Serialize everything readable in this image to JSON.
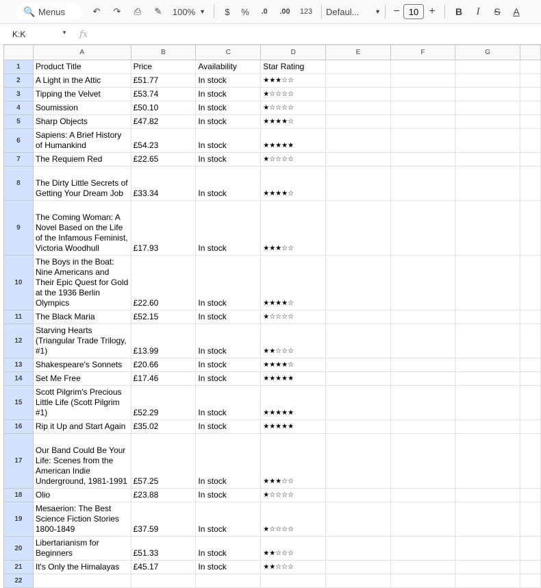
{
  "toolbar": {
    "menus_label": "Menus",
    "zoom": "100%",
    "currency": "$",
    "percent": "%",
    "dec_decrease": ".0",
    "dec_increase": ".00",
    "number_format": "123",
    "font_family": "Defaul...",
    "font_size": "10",
    "bold": "B",
    "italic": "I",
    "strike": "S",
    "text_color": "A"
  },
  "formula_bar": {
    "name_box": "K:K",
    "fx": "fx"
  },
  "columns": [
    "A",
    "B",
    "C",
    "D",
    "E",
    "F",
    "G"
  ],
  "rows": [
    {
      "n": "1",
      "title": "Product Title",
      "price": "Price",
      "availability": "Availability",
      "rating": "Star Rating"
    },
    {
      "n": "2",
      "title": "A Light in the Attic",
      "price": "£51.77",
      "availability": "In stock",
      "rating": "★★★☆☆"
    },
    {
      "n": "3",
      "title": "Tipping the Velvet",
      "price": "£53.74",
      "availability": "In stock",
      "rating": "★☆☆☆☆"
    },
    {
      "n": "4",
      "title": "Soumission",
      "price": "£50.10",
      "availability": "In stock",
      "rating": "★☆☆☆☆"
    },
    {
      "n": "5",
      "title": "Sharp Objects",
      "price": "£47.82",
      "availability": "In stock",
      "rating": "★★★★☆"
    },
    {
      "n": "6",
      "title": "Sapiens: A Brief History of Humankind",
      "price": "£54.23",
      "availability": "In stock",
      "rating": "★★★★★"
    },
    {
      "n": "7",
      "title": "The Requiem Red",
      "price": "£22.65",
      "availability": "In stock",
      "rating": "★☆☆☆☆"
    },
    {
      "n": "8",
      "title": "The Dirty Little Secrets of Getting Your Dream Job",
      "price": "£33.34",
      "availability": "In stock",
      "rating": "★★★★☆"
    },
    {
      "n": "9",
      "title": "The Coming Woman: A Novel Based on the Life of the Infamous Feminist, Victoria Woodhull",
      "price": "£17.93",
      "availability": "In stock",
      "rating": "★★★☆☆"
    },
    {
      "n": "10",
      "title": "The Boys in the Boat: Nine Americans and Their Epic Quest for Gold at the 1936 Berlin Olympics",
      "price": "£22.60",
      "availability": "In stock",
      "rating": "★★★★☆"
    },
    {
      "n": "11",
      "title": "The Black Maria",
      "price": "£52.15",
      "availability": "In stock",
      "rating": "★☆☆☆☆"
    },
    {
      "n": "12",
      "title": "Starving Hearts (Triangular Trade Trilogy, #1)",
      "price": "£13.99",
      "availability": "In stock",
      "rating": "★★☆☆☆"
    },
    {
      "n": "13",
      "title": "Shakespeare's Sonnets",
      "price": "£20.66",
      "availability": "In stock",
      "rating": "★★★★☆"
    },
    {
      "n": "14",
      "title": "Set Me Free",
      "price": "£17.46",
      "availability": "In stock",
      "rating": "★★★★★"
    },
    {
      "n": "15",
      "title": "Scott Pilgrim's Precious Little Life (Scott Pilgrim #1)",
      "price": "£52.29",
      "availability": "In stock",
      "rating": "★★★★★"
    },
    {
      "n": "16",
      "title": "Rip it Up and Start Again",
      "price": "£35.02",
      "availability": "In stock",
      "rating": "★★★★★"
    },
    {
      "n": "17",
      "title": "Our Band Could Be Your Life: Scenes from the American Indie Underground, 1981-1991",
      "price": "£57.25",
      "availability": "In stock",
      "rating": "★★★☆☆"
    },
    {
      "n": "18",
      "title": "Olio",
      "price": "£23.88",
      "availability": "In stock",
      "rating": "★☆☆☆☆"
    },
    {
      "n": "19",
      "title": "Mesaerion: The Best Science Fiction Stories 1800-1849",
      "price": "£37.59",
      "availability": "In stock",
      "rating": "★☆☆☆☆"
    },
    {
      "n": "20",
      "title": "Libertarianism for Beginners",
      "price": "£51.33",
      "availability": "In stock",
      "rating": "★★☆☆☆"
    },
    {
      "n": "21",
      "title": "It's Only the Himalayas",
      "price": "£45.17",
      "availability": "In stock",
      "rating": "★★☆☆☆"
    },
    {
      "n": "22",
      "title": "",
      "price": "",
      "availability": "",
      "rating": ""
    }
  ]
}
